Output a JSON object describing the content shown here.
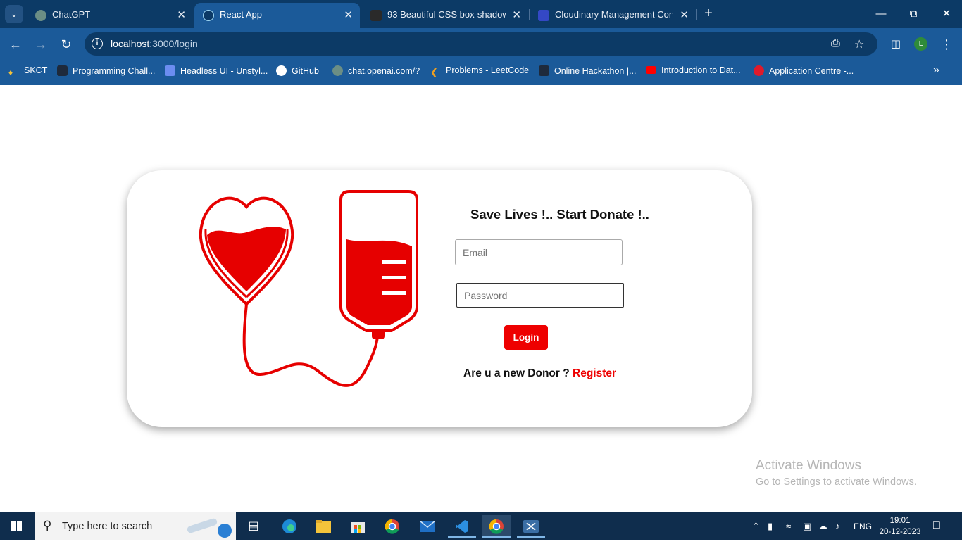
{
  "browser": {
    "tabs": [
      {
        "title": "ChatGPT",
        "favicon": "chatgpt-icon",
        "active": false
      },
      {
        "title": "React App",
        "favicon": "react-icon",
        "active": true
      },
      {
        "title": "93 Beautiful CSS box-shadow ex",
        "favicon": "cursor-icon",
        "active": false
      },
      {
        "title": "Cloudinary Management Conso",
        "favicon": "cloudinary-icon",
        "active": false
      }
    ],
    "url_host": "localhost",
    "url_path": ":3000/login",
    "profile_initial": "L",
    "bookmarks": [
      {
        "label": "SKCT",
        "icon": "skct-icon"
      },
      {
        "label": "Programming Chall...",
        "icon": "hackerrank-icon"
      },
      {
        "label": "Headless UI - Unstyl...",
        "icon": "headlessui-icon"
      },
      {
        "label": "GitHub",
        "icon": "github-icon"
      },
      {
        "label": "chat.openai.com/?",
        "icon": "chatgpt-icon"
      },
      {
        "label": "Problems - LeetCode",
        "icon": "leetcode-icon"
      },
      {
        "label": "Online Hackathon |...",
        "icon": "hackerearth-icon"
      },
      {
        "label": "Introduction to Dat...",
        "icon": "youtube-icon"
      },
      {
        "label": "Application Centre -...",
        "icon": "opera-icon"
      }
    ]
  },
  "login": {
    "title": "Save Lives !.. Start Donate !..",
    "email_placeholder": "Email",
    "password_placeholder": "Password",
    "login_label": "Login",
    "new_donor_text": "Are u a new Donor ? ",
    "register_label": "Register"
  },
  "watermark": {
    "line1": "Activate Windows",
    "line2": "Go to Settings to activate Windows."
  },
  "taskbar": {
    "search_placeholder": "Type here to search",
    "language": "ENG",
    "time": "19:01",
    "date": "20-12-2023"
  },
  "colors": {
    "accent_red": "#ee0000",
    "tabstrip": "#0c3a66",
    "toolbar": "#1b5a99"
  }
}
